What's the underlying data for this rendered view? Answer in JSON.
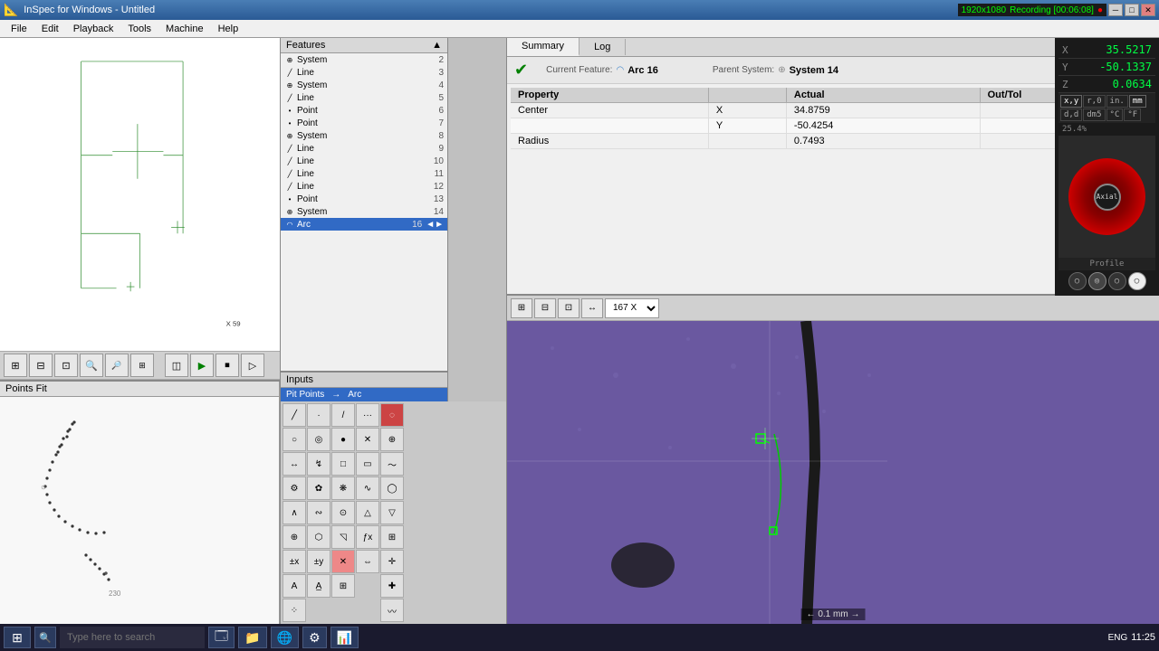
{
  "titlebar": {
    "title": "InSpec for Windows - Untitled",
    "resolution": "1920x1080",
    "recording": "Recording [00:06:08]"
  },
  "menu": {
    "items": [
      "File",
      "Edit",
      "Playback",
      "Tools",
      "Machine",
      "Help"
    ]
  },
  "summary": {
    "tabs": [
      "Summary",
      "Log"
    ],
    "active_tab": "Summary",
    "current_feature_label": "Current Feature:",
    "current_feature_value": "Arc 16",
    "parent_system_label": "Parent System:",
    "parent_system_value": "System 14",
    "table_headers": [
      "Property",
      "",
      "Actual",
      "Out/Tol"
    ],
    "rows": [
      {
        "property": "Center",
        "sub": "X",
        "actual": "34.8759",
        "outtol": ""
      },
      {
        "property": "",
        "sub": "Y",
        "actual": "-50.4254",
        "outtol": ""
      },
      {
        "property": "Radius",
        "sub": "",
        "actual": "0.7493",
        "outtol": ""
      }
    ]
  },
  "coords": {
    "x_label": "X",
    "y_label": "Y",
    "z_label": "Z",
    "x_value": "35.5217",
    "y_value": "-50.1337",
    "z_value": "0.0634",
    "options": [
      "x,y",
      "r,0",
      "in.",
      "mm",
      "d,d",
      "dm5",
      "°C",
      "°F"
    ],
    "zoom_label": "25.4%",
    "axial_label": "Axial",
    "profile_label": "Profile"
  },
  "features": {
    "title": "Features",
    "items": [
      {
        "type": "System",
        "name": "System",
        "num": 2
      },
      {
        "type": "Line",
        "name": "Line",
        "num": 3
      },
      {
        "type": "System",
        "name": "System",
        "num": 4
      },
      {
        "type": "Line",
        "name": "Line",
        "num": 5
      },
      {
        "type": "Point",
        "name": "Point",
        "num": 6
      },
      {
        "type": "Point",
        "name": "Point",
        "num": 7
      },
      {
        "type": "System",
        "name": "System",
        "num": 8
      },
      {
        "type": "Line",
        "name": "Line",
        "num": 9
      },
      {
        "type": "Line",
        "name": "Line",
        "num": 10
      },
      {
        "type": "Line",
        "name": "Line",
        "num": 11
      },
      {
        "type": "Line",
        "name": "Line",
        "num": 12
      },
      {
        "type": "Point",
        "name": "Point",
        "num": 13
      },
      {
        "type": "System",
        "name": "System",
        "num": 14
      },
      {
        "type": "Arc",
        "name": "Arc",
        "num": 16,
        "selected": true
      }
    ]
  },
  "inputs": {
    "title": "Inputs",
    "items": [
      {
        "label": "Pit Points",
        "arrow": "→",
        "value": "Arc"
      }
    ]
  },
  "toolbar": {
    "main_buttons": [
      "⊞",
      "⊟",
      "⊠",
      "⊡",
      "⊷"
    ],
    "play_buttons": [
      "▶",
      "⏹",
      "▷"
    ],
    "zoom_value": "167 X",
    "x_pos": "X 59"
  },
  "points_panel": {
    "title": "Points Fit"
  },
  "camera": {
    "scale_label": "← 0.1 mm →"
  },
  "taskbar": {
    "start_icon": "⊞",
    "search_placeholder": "Type here to search",
    "time": "11:25",
    "date": "",
    "apps": [
      "🗔",
      "📁",
      "🌐",
      "⚙",
      "📊",
      "✉"
    ],
    "sys_indicators": [
      "ENG"
    ]
  }
}
